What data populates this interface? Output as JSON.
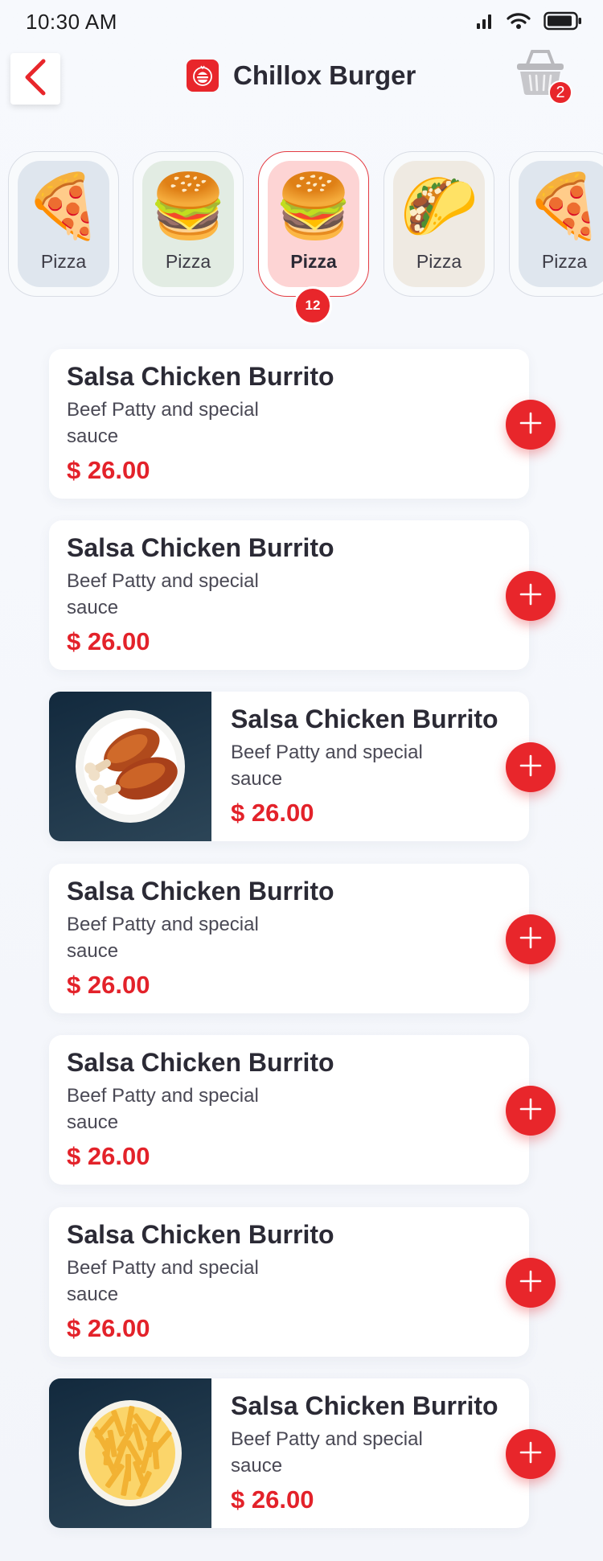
{
  "status": {
    "time": "10:30 AM"
  },
  "header": {
    "title": "Chillox Burger",
    "cart_count": "2"
  },
  "categories": [
    {
      "label": "Pizza",
      "emoji": "🍕",
      "bg": "#dfe6ee"
    },
    {
      "label": "Pizza",
      "emoji": "🍔",
      "bg": "#e2ece3"
    },
    {
      "label": "Pizza",
      "emoji": "🍔",
      "bg": "#fdd4d4",
      "active": true,
      "count": "12"
    },
    {
      "label": "Pizza",
      "emoji": "🌮",
      "bg": "#efeae2"
    },
    {
      "label": "Pizza",
      "emoji": "🍕",
      "bg": "#dfe6ee"
    }
  ],
  "items": [
    {
      "name": "Salsa Chicken Burrito",
      "desc": "Beef Patty and special sauce",
      "price": "$ 26.00"
    },
    {
      "name": "Salsa Chicken Burrito",
      "desc": "Beef Patty and special sauce",
      "price": "$ 26.00"
    },
    {
      "name": "Salsa Chicken Burrito",
      "desc": "Beef Patty and special sauce",
      "price": "$ 26.00",
      "image": "chicken-drumsticks"
    },
    {
      "name": "Salsa Chicken Burrito",
      "desc": "Beef Patty and special sauce",
      "price": "$ 26.00"
    },
    {
      "name": "Salsa Chicken Burrito",
      "desc": "Beef Patty and special sauce",
      "price": "$ 26.00"
    },
    {
      "name": "Salsa Chicken Burrito",
      "desc": "Beef Patty and special sauce",
      "price": "$ 26.00"
    },
    {
      "name": "Salsa Chicken Burrito",
      "desc": "Beef Patty and special sauce",
      "price": "$ 26.00",
      "image": "french-fries"
    }
  ],
  "colors": {
    "accent": "#e8262b",
    "price": "#e3222a",
    "text": "#2b2a35"
  }
}
